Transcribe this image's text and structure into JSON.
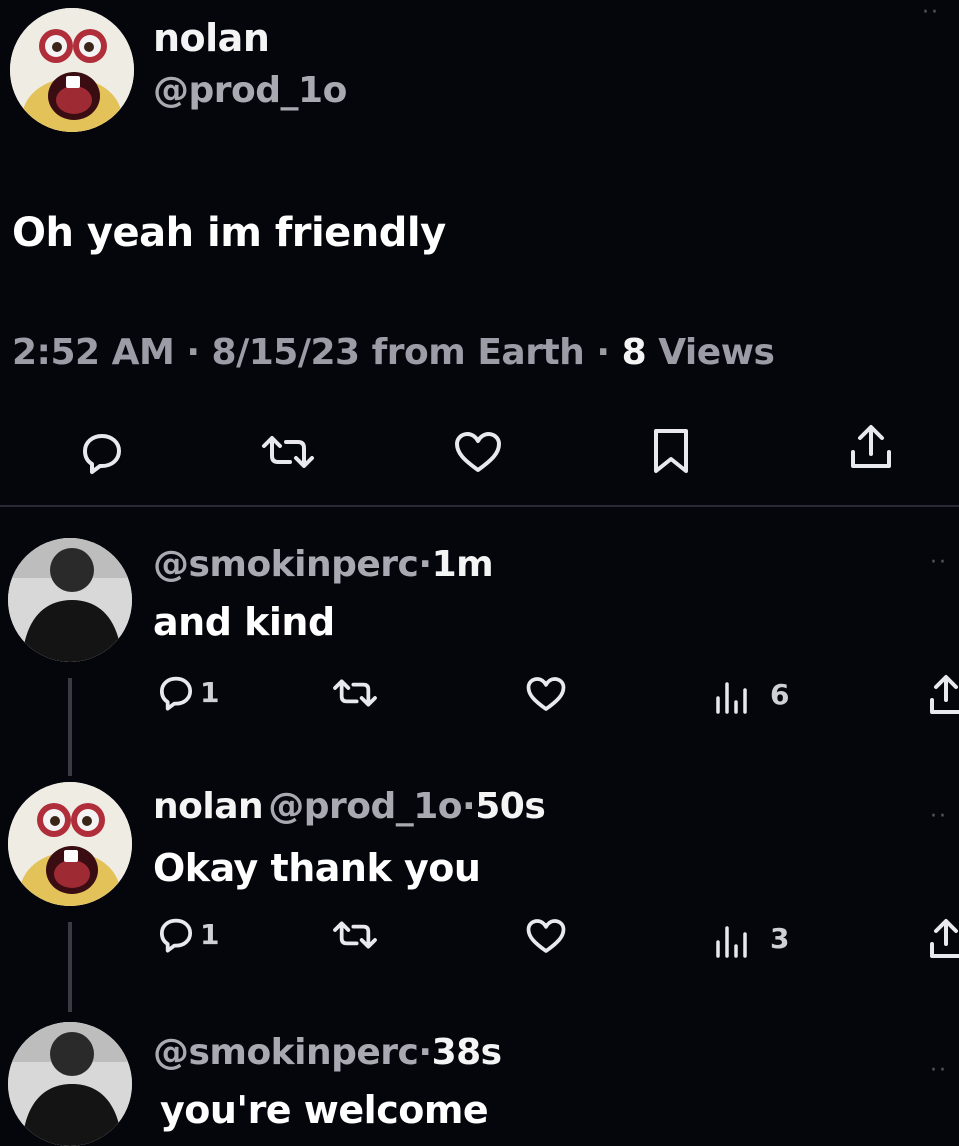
{
  "main_tweet": {
    "name": "nolan",
    "handle": "@prod_1o",
    "text": "Oh yeah im friendly",
    "time": "2:52 AM",
    "date": "8/15/23",
    "source": "from Earth",
    "views_count": "8",
    "views_label": "Views",
    "sep": "·"
  },
  "replies": [
    {
      "handle": "@smokinperc",
      "age": "1m",
      "text": "and kind",
      "reply_count": "1",
      "view_count": "6"
    },
    {
      "name": "nolan",
      "handle": "@prod_1o",
      "age": "50s",
      "text": "Okay thank you",
      "reply_count": "1",
      "view_count": "3"
    },
    {
      "handle": "@smokinperc",
      "age": "38s",
      "text": "you're welcome"
    }
  ],
  "more": "··",
  "colors": {
    "background": "#05050c",
    "secondary_text": "#a9a9b2",
    "icon": "#e8e8ee"
  }
}
